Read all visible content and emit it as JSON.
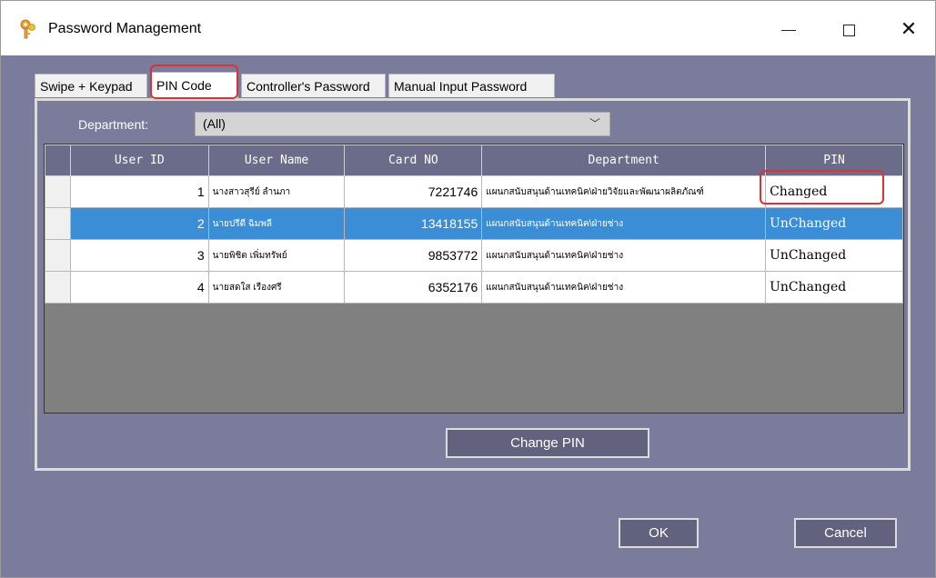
{
  "window": {
    "title": "Password Management",
    "icon": "keys-icon"
  },
  "tabs": [
    {
      "label": "Swipe + Keypad"
    },
    {
      "label": "PIN Code",
      "active": true
    },
    {
      "label": "Controller's Password"
    },
    {
      "label": "Manual Input Password"
    }
  ],
  "filter": {
    "label": "Department:",
    "value": "(All)"
  },
  "grid": {
    "columns": [
      "User ID",
      "User Name",
      "Card NO",
      "Department",
      "PIN"
    ],
    "rows": [
      {
        "id": "1",
        "name": "นางสาวสุรีย์ ลำนภา",
        "card": "7221746",
        "dept": "แผนกสนับสนุนด้านเทคนิค\\ฝ่ายวิจัยและพัฒนาผลิตภัณฑ์",
        "pin": "Changed"
      },
      {
        "id": "2",
        "name": "นายปรีดี ฉิมพลี",
        "card": "13418155",
        "dept": "แผนกสนับสนุนด้านเทคนิค\\ฝ่ายช่าง",
        "pin": "UnChanged"
      },
      {
        "id": "3",
        "name": "นายพิชิต เพิ่มทรัพย์",
        "card": "9853772",
        "dept": "แผนกสนับสนุนด้านเทคนิค\\ฝ่ายช่าง",
        "pin": "UnChanged"
      },
      {
        "id": "4",
        "name": "นายสดใส เรืองศรี",
        "card": "6352176",
        "dept": "แผนกสนับสนุนด้านเทคนิค\\ฝ่ายช่าง",
        "pin": "UnChanged"
      }
    ],
    "selected_row": 2
  },
  "buttons": {
    "change_pin": "Change PIN",
    "ok": "OK",
    "cancel": "Cancel"
  },
  "colors": {
    "background": "#7b7b9c",
    "selection": "#3b8dd6",
    "highlight": "#e03030"
  }
}
